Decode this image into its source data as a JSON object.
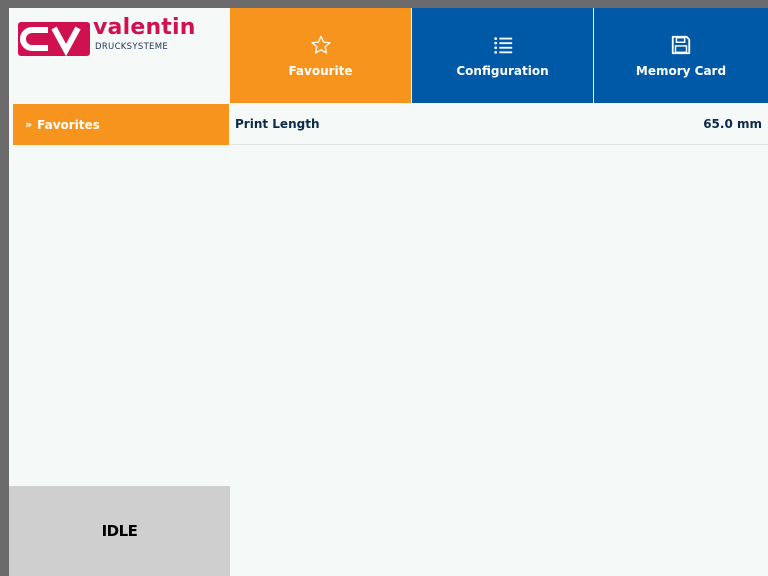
{
  "brand": {
    "name": "valentin",
    "subtitle": "DRUCKSYSTEME",
    "mark": "CV",
    "color": "#d0114f"
  },
  "tabs": [
    {
      "label": "Favourite",
      "icon": "star-icon",
      "active": true,
      "color": "#f7941d"
    },
    {
      "label": "Configuration",
      "icon": "list-icon",
      "active": false,
      "color": "#0059a6"
    },
    {
      "label": "Memory Card",
      "icon": "floppy-disk-icon",
      "active": false,
      "color": "#0059a6"
    }
  ],
  "sidebar": {
    "items": [
      {
        "label": "Favorites",
        "icon": "double-chevron-right-icon",
        "active": true
      }
    ]
  },
  "content": {
    "rows": [
      {
        "label": "Print Length",
        "value": "65.0 mm"
      }
    ]
  },
  "status": {
    "text": "IDLE",
    "background": "#cfcfcf"
  }
}
